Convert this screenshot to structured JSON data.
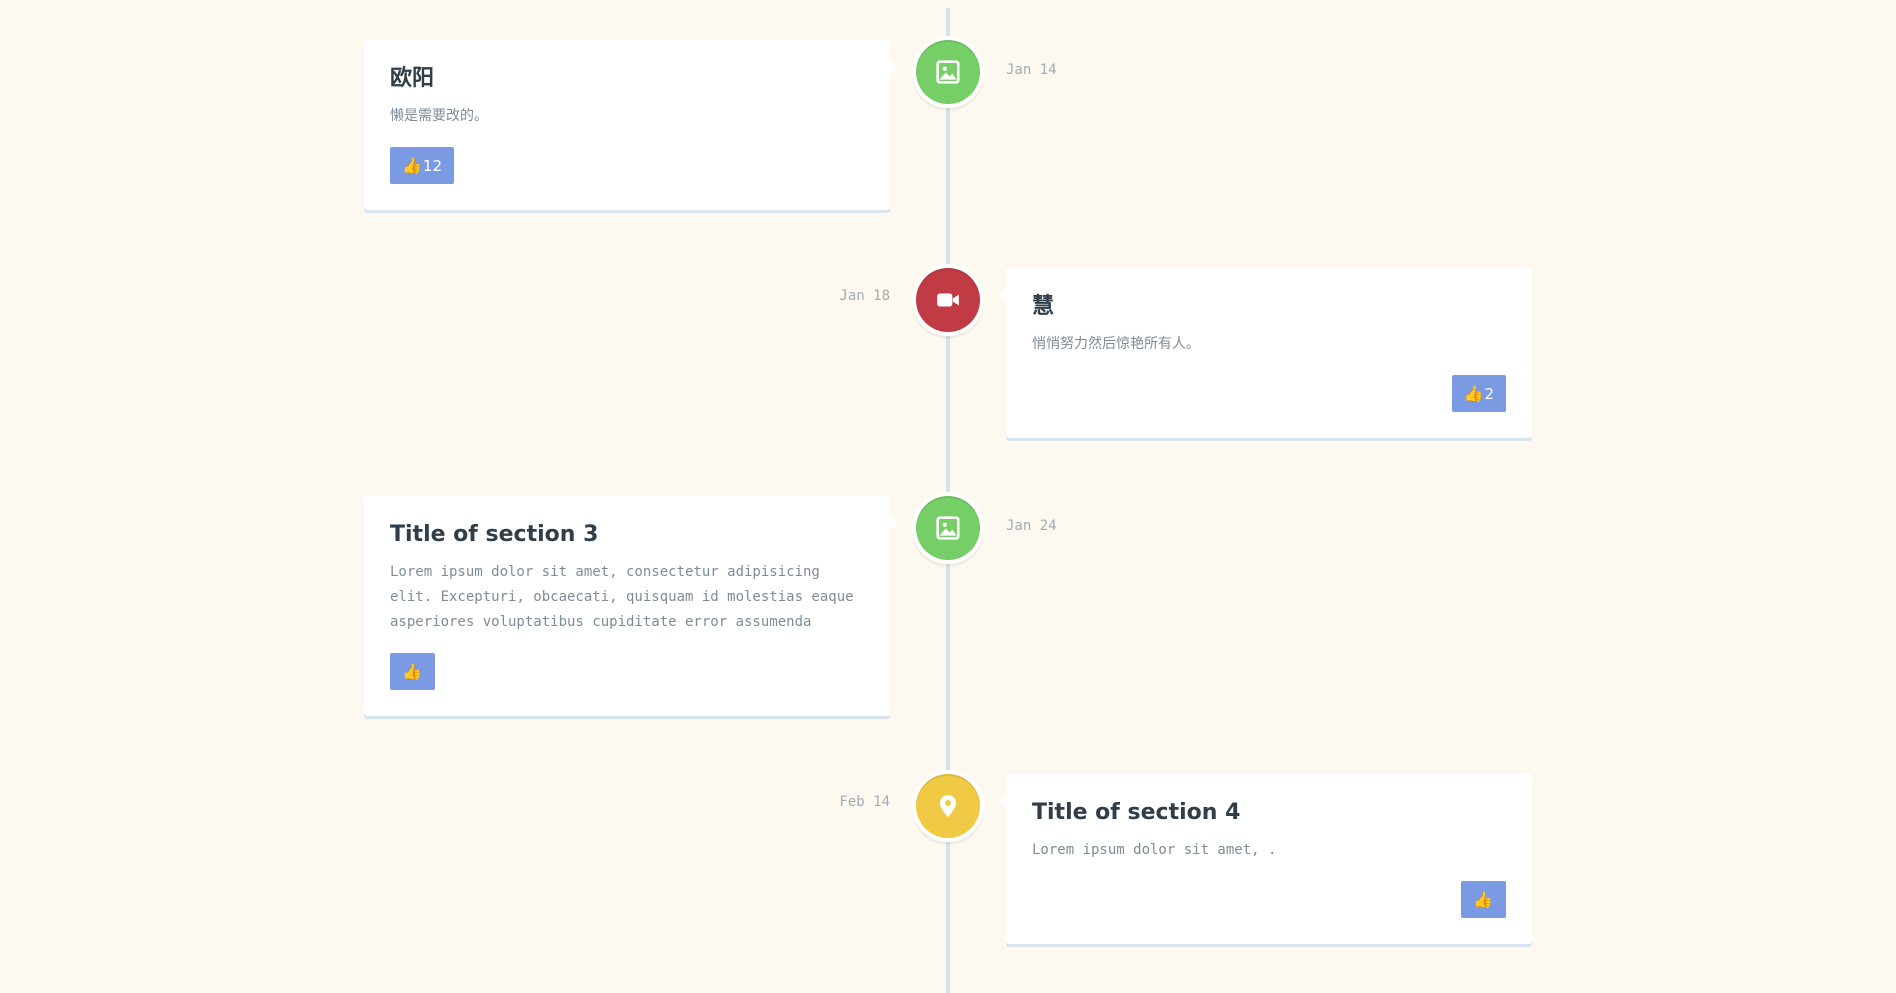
{
  "colors": {
    "background": "#fdf9f1",
    "line": "#d7e4ed",
    "picture_marker": "#75ce66",
    "video_marker": "#c03b44",
    "location_marker": "#f0ca45",
    "like_button": "#7b9ae4",
    "title_text": "#303e49",
    "body_text": "#7f8c97",
    "date_text": "#a3acb3"
  },
  "timeline": [
    {
      "side": "left",
      "icon": "picture-icon",
      "marker_color": "#75ce66",
      "title": "欧阳",
      "text": "懒是需要改的。",
      "likes": "12",
      "date": "Jan 14"
    },
    {
      "side": "right",
      "icon": "video-icon",
      "marker_color": "#c03b44",
      "title": "慧",
      "text": "悄悄努力然后惊艳所有人。",
      "likes": "2",
      "date": "Jan 18"
    },
    {
      "side": "left",
      "icon": "picture-icon",
      "marker_color": "#75ce66",
      "title": "Title of section 3",
      "text": "Lorem ipsum dolor sit amet, consectetur adipisicing elit. Excepturi, obcaecati, quisquam id molestias eaque asperiores voluptatibus cupiditate error assumenda",
      "likes": "",
      "date": "Jan 24"
    },
    {
      "side": "right",
      "icon": "location-icon",
      "marker_color": "#f0ca45",
      "title": "Title of section 4",
      "text": "Lorem ipsum dolor sit amet, .",
      "likes": "",
      "date": "Feb 14"
    }
  ]
}
